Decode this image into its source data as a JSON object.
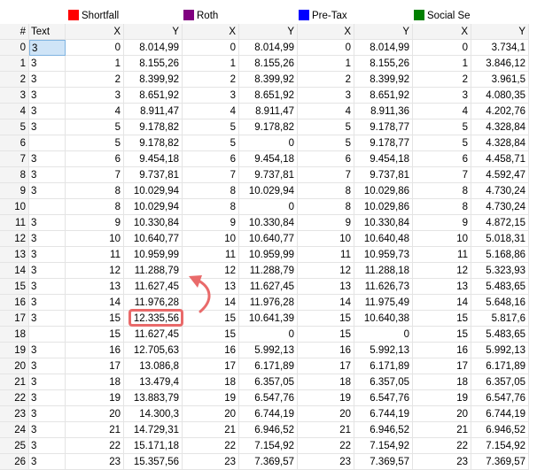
{
  "groups": [
    {
      "name": "Shortfall",
      "color": "#ff0000"
    },
    {
      "name": "Roth",
      "color": "#800080"
    },
    {
      "name": "Pre-Tax",
      "color": "#0000ff"
    },
    {
      "name": "Social Se",
      "color": "#008000"
    }
  ],
  "header": {
    "index": "#",
    "text": "Text",
    "cols": [
      "X",
      "Y",
      "X",
      "Y",
      "X",
      "Y",
      "X",
      "Y"
    ]
  },
  "rows": [
    [
      "0",
      "3",
      "0",
      "8.014,99",
      "0",
      "8.014,99",
      "0",
      "8.014,99",
      "0",
      "3.734,1"
    ],
    [
      "1",
      "3",
      "1",
      "8.155,26",
      "1",
      "8.155,26",
      "1",
      "8.155,26",
      "1",
      "3.846,12"
    ],
    [
      "2",
      "3",
      "2",
      "8.399,92",
      "2",
      "8.399,92",
      "2",
      "8.399,92",
      "2",
      "3.961,5"
    ],
    [
      "3",
      "3",
      "3",
      "8.651,92",
      "3",
      "8.651,92",
      "3",
      "8.651,92",
      "3",
      "4.080,35"
    ],
    [
      "4",
      "3",
      "4",
      "8.911,47",
      "4",
      "8.911,47",
      "4",
      "8.911,36",
      "4",
      "4.202,76"
    ],
    [
      "5",
      "3",
      "5",
      "9.178,82",
      "5",
      "9.178,82",
      "5",
      "9.178,77",
      "5",
      "4.328,84"
    ],
    [
      "6",
      "",
      "5",
      "9.178,82",
      "5",
      "0",
      "5",
      "9.178,77",
      "5",
      "4.328,84"
    ],
    [
      "7",
      "3",
      "6",
      "9.454,18",
      "6",
      "9.454,18",
      "6",
      "9.454,18",
      "6",
      "4.458,71"
    ],
    [
      "8",
      "3",
      "7",
      "9.737,81",
      "7",
      "9.737,81",
      "7",
      "9.737,81",
      "7",
      "4.592,47"
    ],
    [
      "9",
      "3",
      "8",
      "10.029,94",
      "8",
      "10.029,94",
      "8",
      "10.029,86",
      "8",
      "4.730,24"
    ],
    [
      "10",
      "",
      "8",
      "10.029,94",
      "8",
      "0",
      "8",
      "10.029,86",
      "8",
      "4.730,24"
    ],
    [
      "11",
      "3",
      "9",
      "10.330,84",
      "9",
      "10.330,84",
      "9",
      "10.330,84",
      "9",
      "4.872,15"
    ],
    [
      "12",
      "3",
      "10",
      "10.640,77",
      "10",
      "10.640,77",
      "10",
      "10.640,48",
      "10",
      "5.018,31"
    ],
    [
      "13",
      "3",
      "11",
      "10.959,99",
      "11",
      "10.959,99",
      "11",
      "10.959,73",
      "11",
      "5.168,86"
    ],
    [
      "14",
      "3",
      "12",
      "11.288,79",
      "12",
      "11.288,79",
      "12",
      "11.288,18",
      "12",
      "5.323,93"
    ],
    [
      "15",
      "3",
      "13",
      "11.627,45",
      "13",
      "11.627,45",
      "13",
      "11.626,73",
      "13",
      "5.483,65"
    ],
    [
      "16",
      "3",
      "14",
      "11.976,28",
      "14",
      "11.976,28",
      "14",
      "11.975,49",
      "14",
      "5.648,16"
    ],
    [
      "17",
      "3",
      "15",
      "12.335,56",
      "15",
      "10.641,39",
      "15",
      "10.640,38",
      "15",
      "5.817,6"
    ],
    [
      "18",
      "",
      "15",
      "11.627,45",
      "15",
      "0",
      "15",
      "0",
      "15",
      "5.483,65"
    ],
    [
      "19",
      "3",
      "16",
      "12.705,63",
      "16",
      "5.992,13",
      "16",
      "5.992,13",
      "16",
      "5.992,13"
    ],
    [
      "20",
      "3",
      "17",
      "13.086,8",
      "17",
      "6.171,89",
      "17",
      "6.171,89",
      "17",
      "6.171,89"
    ],
    [
      "21",
      "3",
      "18",
      "13.479,4",
      "18",
      "6.357,05",
      "18",
      "6.357,05",
      "18",
      "6.357,05"
    ],
    [
      "22",
      "3",
      "19",
      "13.883,79",
      "19",
      "6.547,76",
      "19",
      "6.547,76",
      "19",
      "6.547,76"
    ],
    [
      "23",
      "3",
      "20",
      "14.300,3",
      "20",
      "6.744,19",
      "20",
      "6.744,19",
      "20",
      "6.744,19"
    ],
    [
      "24",
      "3",
      "21",
      "14.729,31",
      "21",
      "6.946,52",
      "21",
      "6.946,52",
      "21",
      "6.946,52"
    ],
    [
      "25",
      "3",
      "22",
      "15.171,18",
      "22",
      "7.154,92",
      "22",
      "7.154,92",
      "22",
      "7.154,92"
    ],
    [
      "26",
      "3",
      "23",
      "15.357,56",
      "23",
      "7.369,57",
      "23",
      "7.369,57",
      "23",
      "7.369,57"
    ]
  ],
  "annotation": {
    "color": "#e96a6a"
  }
}
